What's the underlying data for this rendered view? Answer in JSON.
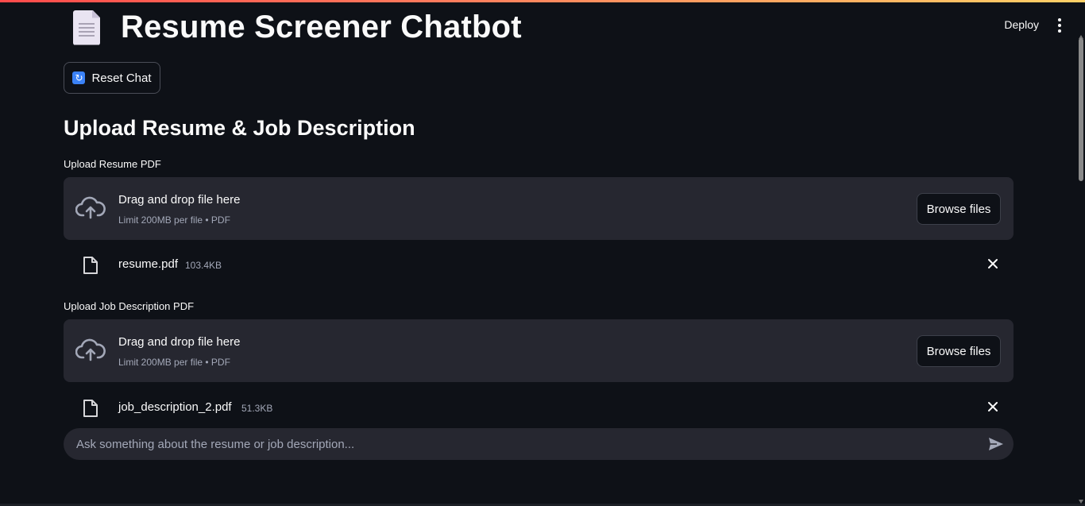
{
  "app": {
    "title": "Resume Screener Chatbot",
    "deploy_label": "Deploy"
  },
  "toolbar": {
    "reset_label": "Reset Chat"
  },
  "section": {
    "heading": "Upload Resume & Job Description"
  },
  "uploaders": [
    {
      "label": "Upload Resume PDF",
      "drop_text": "Drag and drop file here",
      "limit_text": "Limit 200MB per file • PDF",
      "browse_label": "Browse files",
      "file": {
        "name": "resume.pdf",
        "size": "103.4KB"
      }
    },
    {
      "label": "Upload Job Description PDF",
      "drop_text": "Drag and drop file here",
      "limit_text": "Limit 200MB per file • PDF",
      "browse_label": "Browse files",
      "file": {
        "name": "job_description_2.pdf",
        "size": "51.3KB"
      }
    }
  ],
  "chat": {
    "placeholder": "Ask something about the resume or job description..."
  },
  "icons": {
    "title": "document-icon",
    "reset": "refresh-icon",
    "upload": "cloud-upload-icon",
    "file": "file-icon",
    "remove": "close-icon",
    "send": "send-icon",
    "menu": "kebab-menu-icon"
  },
  "colors": {
    "background": "#0e1117",
    "surface": "#262730",
    "text": "#fafafa",
    "muted": "#a3a8b8",
    "accent_bar": "#ff4b4b"
  }
}
